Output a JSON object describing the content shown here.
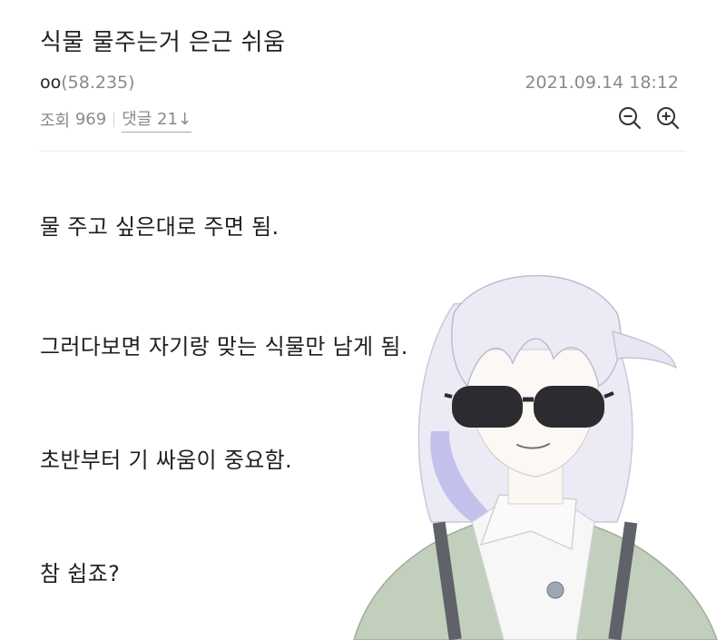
{
  "post": {
    "title": "식물 물주는거 은근 쉬움",
    "author": "oo",
    "author_ip": "(58.235)",
    "date": "2021.09.14 18:12",
    "views_label": "조회",
    "views": "969",
    "comments_label": "댓글 21",
    "comments_arrow": "↓"
  },
  "zoom": {
    "zoom_out_icon": "zoom-out-icon",
    "zoom_in_icon": "zoom-in-icon"
  },
  "content": {
    "lines": [
      "물 주고 싶은대로 주면 됨.",
      "그러다보면 자기랑 맞는 식물만 남게 됨.",
      "초반부터 기 싸움이 중요함.",
      "참 쉽죠?"
    ]
  },
  "colors": {
    "muted": "#8a8a8a",
    "text": "#1f1f1f",
    "hair": "#d9d9ec",
    "jacket": "#b9c7b2"
  }
}
